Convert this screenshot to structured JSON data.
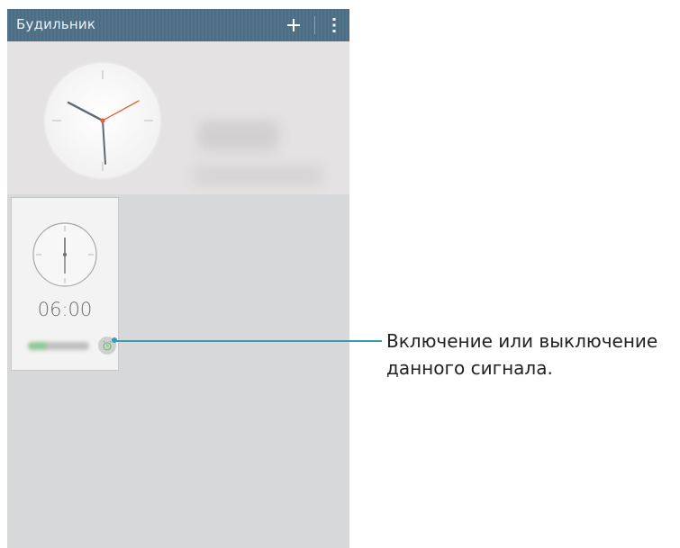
{
  "actionbar": {
    "title": "Будильник",
    "add_icon": "plus-icon",
    "menu_icon": "more-vertical-icon",
    "color": "#4d6f86"
  },
  "world_clock": {
    "hands": {
      "hour": "10:10",
      "second_hand_color": "#e8603a"
    }
  },
  "alarms": [
    {
      "time": "06:00",
      "enabled_icon": "alarm-clock-icon",
      "accent": "#7fbf86"
    }
  ],
  "callout": {
    "line1": "Включение или выключение",
    "line2": "данного сигнала.",
    "color": "#3a9bb8"
  }
}
